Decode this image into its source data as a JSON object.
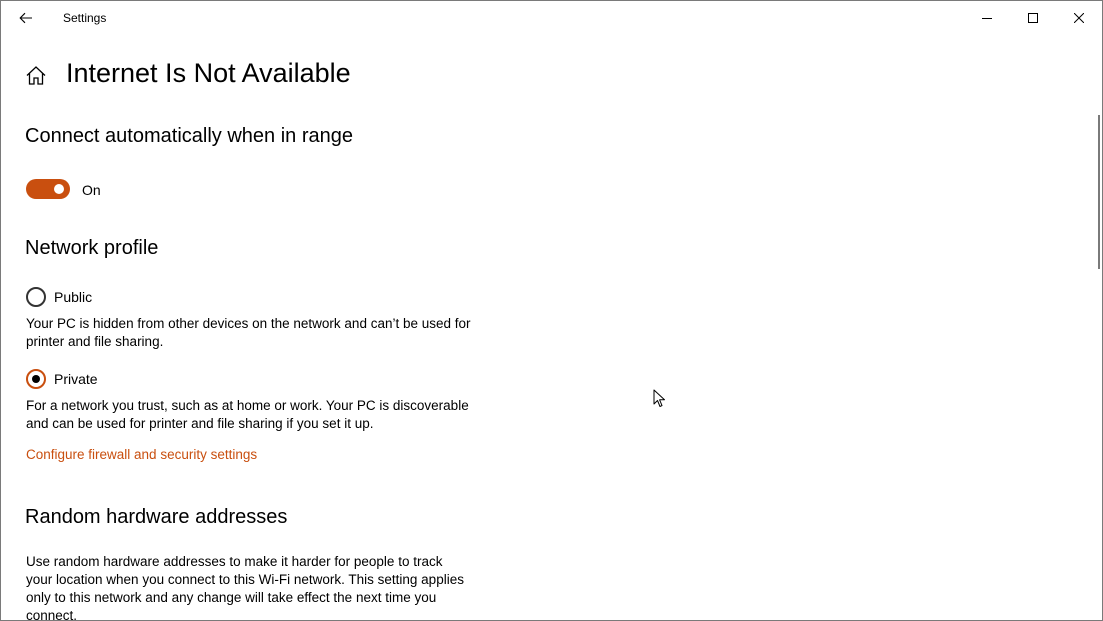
{
  "window": {
    "title": "Settings"
  },
  "page": {
    "title": "Internet Is Not Available"
  },
  "auto_connect": {
    "heading": "Connect automatically when in range",
    "toggle_state": "On",
    "enabled": true
  },
  "network_profile": {
    "heading": "Network profile",
    "options": [
      {
        "label": "Public",
        "selected": false,
        "description": "Your PC is hidden from other devices on the network and can’t be used for printer and file sharing."
      },
      {
        "label": "Private",
        "selected": true,
        "description": "For a network you trust, such as at home or work. Your PC is discoverable and can be used for printer and file sharing if you set it up."
      }
    ],
    "firewall_link": "Configure firewall and security settings"
  },
  "random_hw": {
    "heading": "Random hardware addresses",
    "description": "Use random hardware addresses to make it harder for people to track your location when you connect to this Wi-Fi network. This setting applies only to this network and any change will take effect the next time you connect."
  },
  "colors": {
    "accent": "#c94f0f"
  },
  "icons": {
    "back": "back-arrow-icon",
    "home": "home-icon",
    "minimize": "minimize-icon",
    "maximize": "maximize-icon",
    "close": "close-icon",
    "cursor": "mouse-pointer-icon"
  }
}
